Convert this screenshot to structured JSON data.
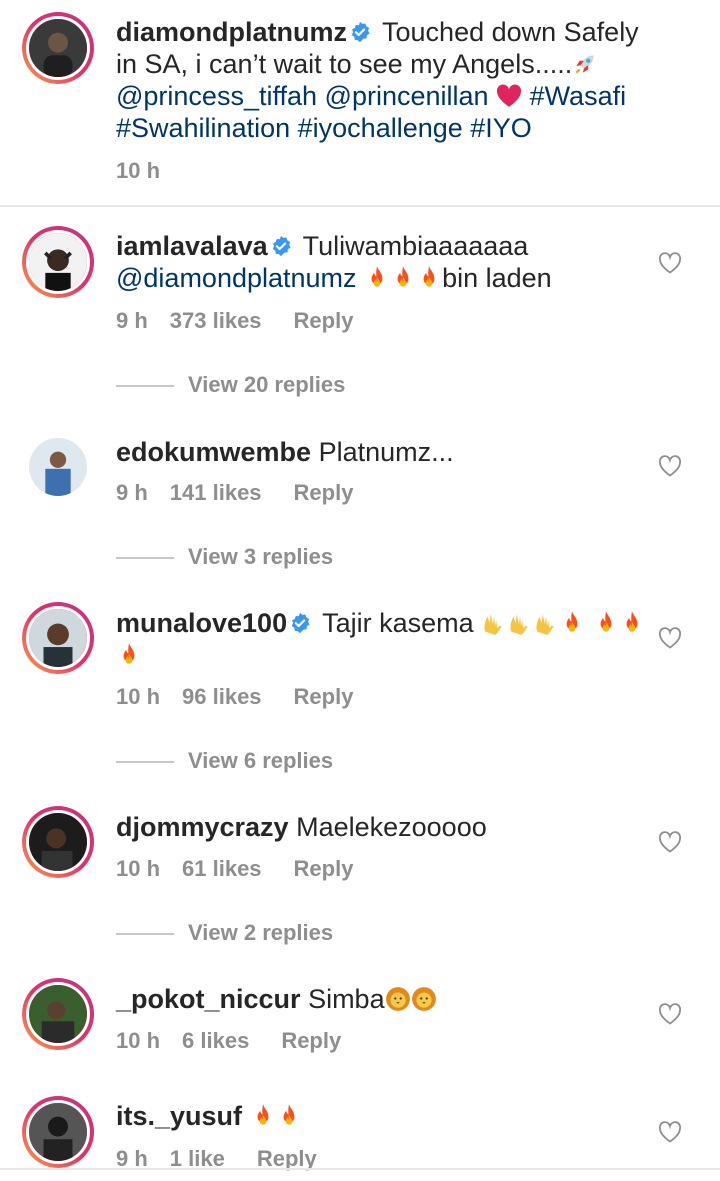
{
  "caption": {
    "username": "diamondplatnumz",
    "text_1": "Touched down Safely in SA, i can’t wait to see my Angels.....",
    "mention_1": "@princess_tiffah",
    "mention_2": "@princenillan",
    "tag_1": "#Wasafi",
    "tag_2": "#Swahilination",
    "tag_3": "#iyochallenge",
    "tag_4": "#IYO",
    "time": "10 h"
  },
  "comments": [
    {
      "username": "iamlavalava",
      "text": "Tuliwambiaaaaaaa",
      "mention": "@diamondplatnumz",
      "text_after": "bin laden",
      "time": "9 h",
      "likes": "373 likes",
      "reply": "Reply",
      "view_replies": "View 20 replies"
    },
    {
      "username": "edokumwembe",
      "text": "Platnumz...",
      "time": "9 h",
      "likes": "141 likes",
      "reply": "Reply",
      "view_replies": "View 3 replies"
    },
    {
      "username": "munalove100",
      "text": "Tajir kasema",
      "time": "10 h",
      "likes": "96 likes",
      "reply": "Reply",
      "view_replies": "View 6 replies"
    },
    {
      "username": "djommycrazy",
      "text": "Maelekezooooo",
      "time": "10 h",
      "likes": "61 likes",
      "reply": "Reply",
      "view_replies": "View 2 replies"
    },
    {
      "username": "_pokot_niccur",
      "text": "Simba",
      "time": "10 h",
      "likes": "6 likes",
      "reply": "Reply"
    },
    {
      "username": "its._yusuf",
      "text": "",
      "time": "9 h",
      "likes": "1 like",
      "reply": "Reply"
    }
  ],
  "colors": {
    "mention": "#003569",
    "meta": "#8e8e8e",
    "verified": "#3897f0"
  }
}
